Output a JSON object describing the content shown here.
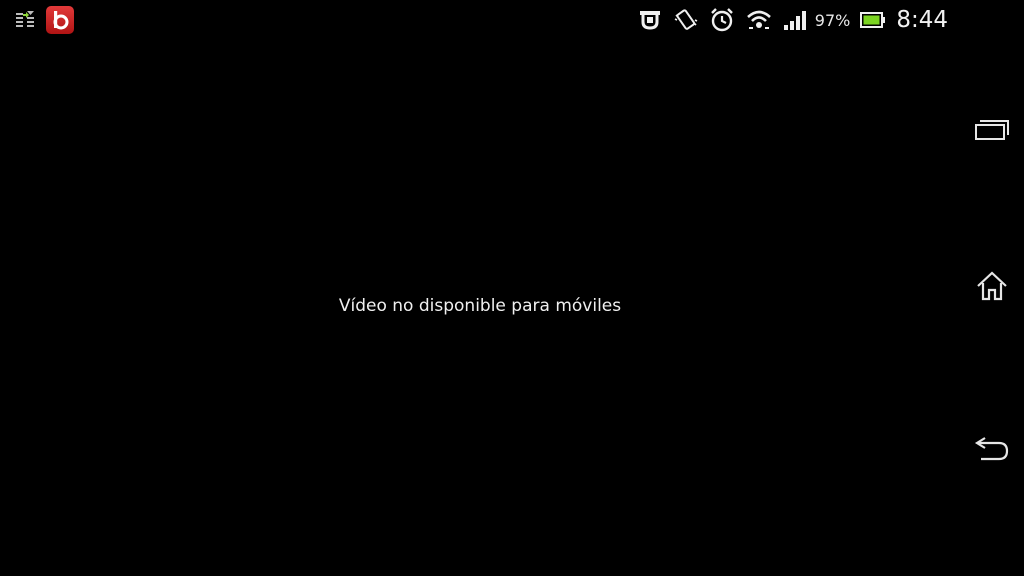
{
  "status_bar": {
    "notification_icons": [
      "usb-transfer-icon",
      "app-b-icon"
    ],
    "app_badge_letter": "b",
    "system_icons": [
      "lock-icon",
      "vibrate-icon",
      "alarm-icon",
      "wifi-icon",
      "cell-signal-icon",
      "battery-icon"
    ],
    "battery_percent": "97%",
    "time": "8:44"
  },
  "main": {
    "message": "Vídeo no disponible para móviles"
  },
  "nav_bar": {
    "buttons": [
      "recent-apps-icon",
      "home-icon",
      "back-icon"
    ]
  },
  "colors": {
    "background": "#000000",
    "battery_fill": "#7bd321",
    "app_badge": "#d42626"
  }
}
